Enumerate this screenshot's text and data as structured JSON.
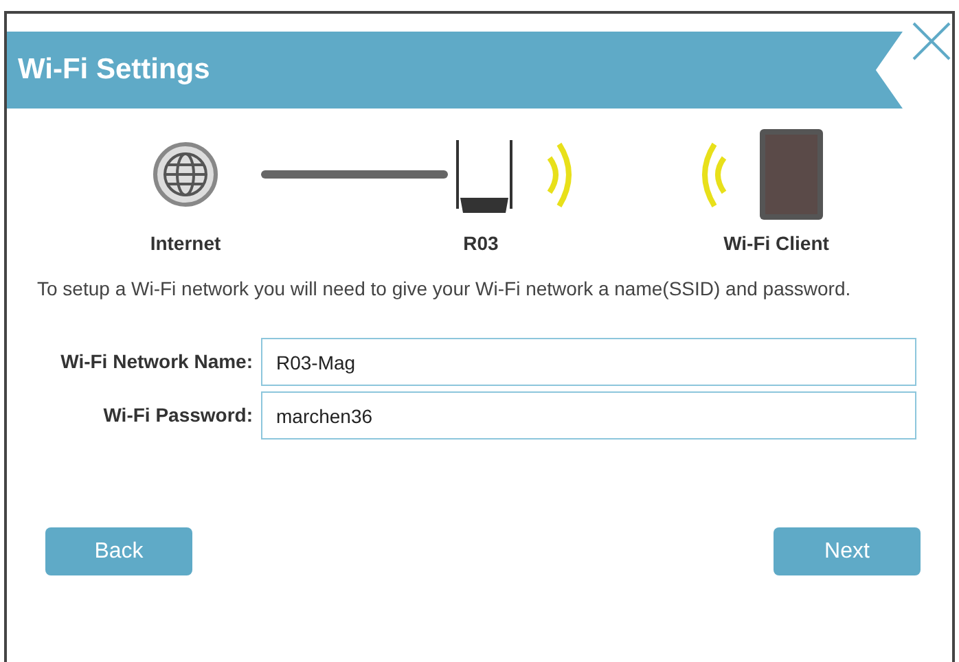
{
  "window": {
    "title": "Wi-Fi Settings"
  },
  "diagram": {
    "nodes": [
      {
        "label": "Internet"
      },
      {
        "label": "R03"
      },
      {
        "label": "Wi-Fi Client"
      }
    ]
  },
  "description": "To setup a Wi-Fi network you will need to give your Wi-Fi network a name(SSID) and password.",
  "fields": [
    {
      "label": "Wi-Fi Network Name:",
      "value": "R03-Mag"
    },
    {
      "label": "Wi-Fi Password:",
      "value": "marchen36"
    }
  ],
  "buttons": [
    {
      "label": "Back"
    },
    {
      "label": "Next"
    }
  ]
}
